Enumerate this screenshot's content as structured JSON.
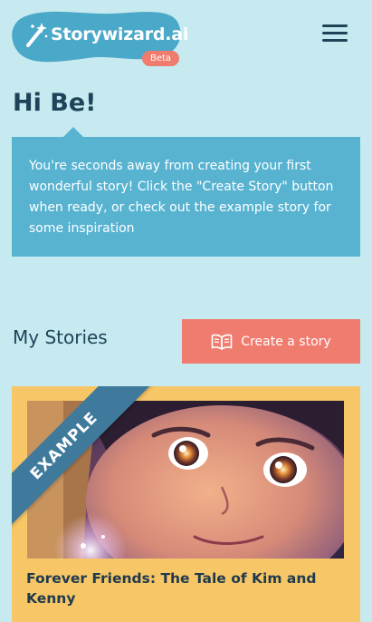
{
  "header": {
    "logo_text": "Storywizard.ai",
    "beta_label": "Beta",
    "logo_icon": "magic-wand-icon",
    "menu_icon": "hamburger-menu-icon"
  },
  "greeting": "Hi Be!",
  "info_box": {
    "text": "You're seconds away from creating your first wonderful story! Click the \"Create Story\" button when ready, or check out the example story for some inspiration"
  },
  "stories_section": {
    "title": "My Stories",
    "create_button_label": "Create a story",
    "create_button_icon": "open-book-icon"
  },
  "stories": [
    {
      "ribbon_label": "EXAMPLE",
      "title": "Forever Friends: The Tale of Kim and Kenny"
    }
  ],
  "colors": {
    "background": "#c6eaf0",
    "logo_blob": "#4aa8c8",
    "accent_coral": "#ef7c6f",
    "info_box": "#58b3d1",
    "card": "#f6c667",
    "ribbon": "#3f7a9c",
    "text_dark": "#1f4358"
  }
}
